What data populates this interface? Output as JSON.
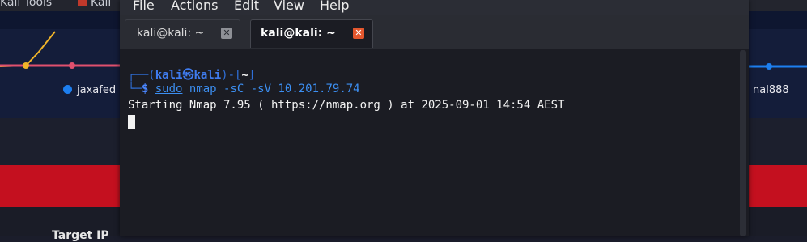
{
  "background": {
    "bookmarks": [
      "Kali Tools",
      "Kali"
    ],
    "legend_left": "jaxafed",
    "legend_right": "nal888",
    "bottom_text": "Target IP"
  },
  "terminal": {
    "menu": [
      "File",
      "Actions",
      "Edit",
      "View",
      "Help"
    ],
    "tabs": [
      {
        "label": "kali@kali: ~",
        "active": false,
        "close": "✕"
      },
      {
        "label": "kali@kali: ~",
        "active": true,
        "close": "✕"
      }
    ],
    "prompt": {
      "top_left": "┌──(",
      "user": "kali",
      "at": "㉿",
      "host": "kali",
      "mid": ")-[",
      "path": "~",
      "end": "]",
      "bottom_left": "└─",
      "dollar": "$",
      "command_sudo": "sudo",
      "command_rest": "nmap -sC -sV 10.201.79.74"
    },
    "output_line": "Starting Nmap 7.95 ( https://nmap.org ) at 2025-09-01 14:54 AEST"
  },
  "colors": {
    "accent_red": "#c4101f",
    "prompt_blue": "#3f7cf0",
    "close_orange": "#e4572e"
  }
}
